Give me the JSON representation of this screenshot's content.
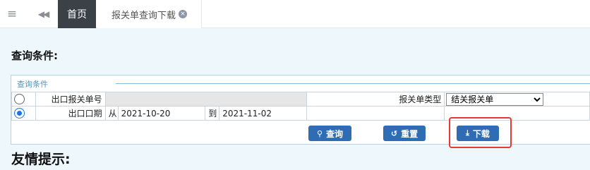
{
  "topbar": {
    "menu_icon": "≡",
    "back_icon": "◀◀",
    "home_tab": "首页",
    "current_tab": "报关单查询下载",
    "close_icon": "×"
  },
  "section_title": "查询条件:",
  "panel": {
    "legend": "查询条件",
    "row1": {
      "selected": false,
      "label": "出口报关单号",
      "value": "",
      "type_label": "报关单类型",
      "type_selected": "结关报关单"
    },
    "row2": {
      "selected": true,
      "label": "出口口期",
      "from_label": "从",
      "from_value": "2021-10-20",
      "to_label": "到",
      "to_value": "2021-11-02"
    }
  },
  "buttons": {
    "query": "查询",
    "reset": "重置",
    "download": "下载"
  },
  "tips_title": "友情提示:",
  "colors": {
    "accent": "#2e6db4",
    "highlight": "#e53935",
    "tab_active_bg": "#3c4147"
  }
}
